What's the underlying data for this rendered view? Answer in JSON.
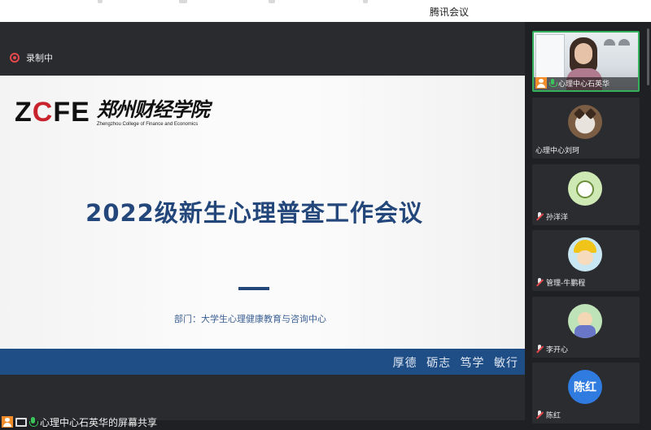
{
  "app": {
    "title": "腾讯会议"
  },
  "recording": {
    "label": "录制中"
  },
  "slide": {
    "logo_mark": "ZCFE",
    "logo_name_cn": "郑州财经学院",
    "logo_name_en": "Zhengzhou College of Finance and Economics",
    "title": "2022级新生心理普查工作会议",
    "department": "部门：大学生心理健康教育与咨询中心",
    "motto": "厚德 砺志 笃学 敏行"
  },
  "share_status": {
    "label": "心理中心石英华的屏幕共享"
  },
  "participants": [
    {
      "name": "心理中心石英华",
      "mic": "on",
      "video": true,
      "speaking": true
    },
    {
      "name": "心理中心刘珂",
      "mic": "none",
      "avatar": "cat-icon"
    },
    {
      "name": "孙洋洋",
      "mic": "muted",
      "avatar": "cartoon-avatar"
    },
    {
      "name": "管理-牛鹏程",
      "mic": "muted",
      "avatar": "cartoon-avatar"
    },
    {
      "name": "李开心",
      "mic": "muted",
      "avatar": "cartoon-avatar"
    },
    {
      "name": "陈红",
      "mic": "muted",
      "avatar_text": "陈红",
      "avatar_color": "#2f7be0"
    }
  ],
  "colors": {
    "accent_navy": "#23477b",
    "band_blue": "#1f4d86",
    "active_green": "#35b05a",
    "muted_red": "#e5484d"
  }
}
